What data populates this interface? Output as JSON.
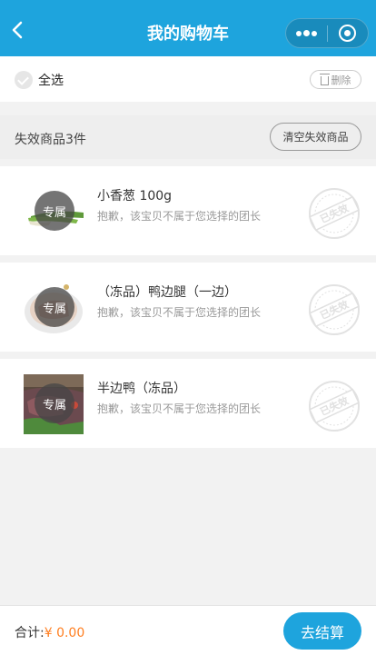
{
  "nav": {
    "title": "我的购物车",
    "back_icon": "chevron-left-icon",
    "more_icon": "more-dots-icon",
    "close_icon": "target-circle-icon"
  },
  "toolbar": {
    "select_all_label": "全选",
    "delete_label": "删除"
  },
  "invalid_section": {
    "title": "失效商品3件",
    "clear_label": "清空失效商品"
  },
  "items": [
    {
      "name": "小香葱 100g",
      "badge": "专属",
      "reason": "抱歉，该宝贝不属于您选择的团长",
      "stamp": "已失效"
    },
    {
      "name": "（冻品）鸭边腿（一边）",
      "badge": "专属",
      "reason": "抱歉，该宝贝不属于您选择的团长",
      "stamp": "已失效"
    },
    {
      "name": "半边鸭（冻品）",
      "badge": "专属",
      "reason": "抱歉，该宝贝不属于您选择的团长",
      "stamp": "已失效"
    }
  ],
  "footer": {
    "total_label": "合计:",
    "total_amount": "¥ 0.00",
    "checkout_label": "去结算"
  },
  "colors": {
    "brand": "#1ea4dd",
    "price": "#ff7e1f",
    "page_bg": "#f2f2f2"
  }
}
